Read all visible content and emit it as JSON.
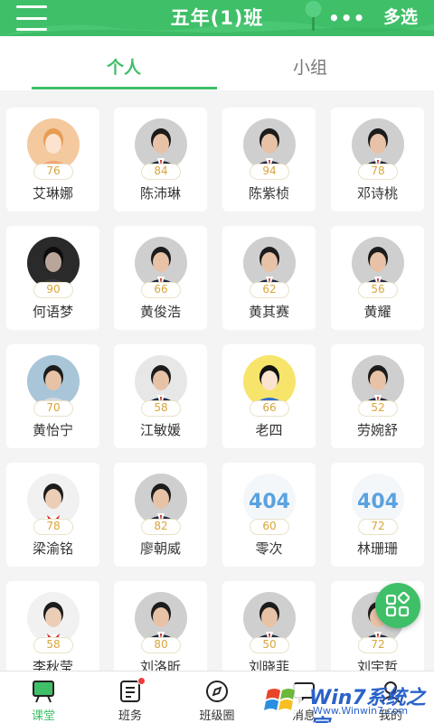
{
  "header": {
    "title": "五年(1)班",
    "more": "•••",
    "multi_select": "多选",
    "color": "#3fbf68"
  },
  "tabs": {
    "personal": "个人",
    "group": "小组"
  },
  "students": [
    {
      "name": "艾琳娜",
      "score": "76",
      "avatar": "cartoon-girl"
    },
    {
      "name": "陈沛琳",
      "score": "84",
      "avatar": "uniform"
    },
    {
      "name": "陈紫桢",
      "score": "94",
      "avatar": "uniform"
    },
    {
      "name": "邓诗桃",
      "score": "78",
      "avatar": "uniform"
    },
    {
      "name": "何语梦",
      "score": "90",
      "avatar": "dark-photo"
    },
    {
      "name": "黄俊浩",
      "score": "66",
      "avatar": "uniform"
    },
    {
      "name": "黄其赛",
      "score": "62",
      "avatar": "uniform"
    },
    {
      "name": "黄耀",
      "score": "56",
      "avatar": "uniform"
    },
    {
      "name": "黄怡宁",
      "score": "70",
      "avatar": "outdoor"
    },
    {
      "name": "江敏媛",
      "score": "58",
      "avatar": "uniform-small"
    },
    {
      "name": "老四",
      "score": "66",
      "avatar": "cartoon-boy"
    },
    {
      "name": "劳婉舒",
      "score": "52",
      "avatar": "uniform"
    },
    {
      "name": "梁渝铭",
      "score": "78",
      "avatar": "red-scarf"
    },
    {
      "name": "廖朝威",
      "score": "82",
      "avatar": "uniform"
    },
    {
      "name": "零次",
      "score": "60",
      "avatar": "404"
    },
    {
      "name": "林珊珊",
      "score": "72",
      "avatar": "404"
    },
    {
      "name": "李秋莹",
      "score": "58",
      "avatar": "red-scarf"
    },
    {
      "name": "刘洛昕",
      "score": "80",
      "avatar": "uniform"
    },
    {
      "name": "刘晓菲",
      "score": "50",
      "avatar": "uniform"
    },
    {
      "name": "刘宇哲",
      "score": "72",
      "avatar": "uniform"
    }
  ],
  "fab": {
    "icon": "grid-apps-icon"
  },
  "bottom_nav": [
    {
      "label": "课堂",
      "icon": "classroom-icon",
      "active": true
    },
    {
      "label": "班务",
      "icon": "tasks-icon",
      "badge": true
    },
    {
      "label": "班级圈",
      "icon": "compass-icon"
    },
    {
      "label": "消息",
      "icon": "message-icon"
    },
    {
      "label": "我的",
      "icon": "profile-icon"
    }
  ],
  "watermark": {
    "text": "Win7系统之家",
    "url": "Www.Winwin7.com"
  }
}
